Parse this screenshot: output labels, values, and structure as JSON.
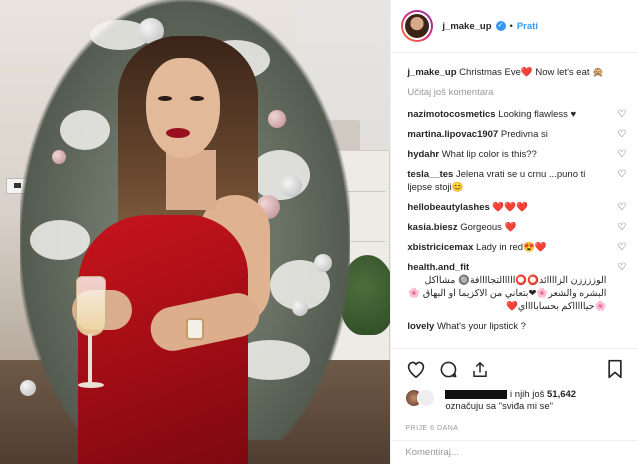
{
  "header": {
    "username": "j_make_up",
    "verified_symbol": "✓",
    "separator": "•",
    "follow_label": "Prati"
  },
  "caption": {
    "username": "j_make_up",
    "text": "Christmas Eve",
    "emoji1": "❤️",
    "text2": "Now let's eat",
    "emoji2": "🙊"
  },
  "load_more_label": "Učitaj još komentara",
  "comments": [
    {
      "user": "nazimotocosmetics",
      "text": "Looking flawless ♥"
    },
    {
      "user": "martina.lipovac1907",
      "text": "Predivna si"
    },
    {
      "user": "hydahr",
      "text": "What lip color is this??"
    },
    {
      "user": "tesla__tes",
      "text": "Jelena vrati se u crnu ...puno ti ljepse stoji😊"
    },
    {
      "user": "hellobeautylashes",
      "text": "❤️❤️❤️"
    },
    {
      "user": "kasia.biesz",
      "text": "Gorgeous ❤️"
    },
    {
      "user": "xbistricicemax",
      "text": "Lady in red😍❤️"
    },
    {
      "user": "health.and_fit",
      "text": "الوززززن الزاااائد⭕⭕ااااالتجاااافة🔘 مشااكل البشره والشعر🌸❤بتعاني من الاكزيما او البهاق 🌸🌸حياااااكم بحسابااااي❤️"
    },
    {
      "user": "lovely",
      "text": "What's your lipstick ?"
    }
  ],
  "likes": {
    "prefix": "i njih još",
    "count": "51,642",
    "suffix": "označuju sa \"sviđa mi se\""
  },
  "timestamp": "PRIJE 6 DANA",
  "add_comment_placeholder": "Komentiraj...",
  "icons": [
    "heart-outline-icon",
    "comment-icon",
    "share-icon",
    "bookmark-icon",
    "like-small-icon",
    "more-options-icon"
  ],
  "colors": {
    "accent": "#3897f0",
    "text": "#262626",
    "muted": "#999999",
    "like_red": "#ed1b24"
  }
}
